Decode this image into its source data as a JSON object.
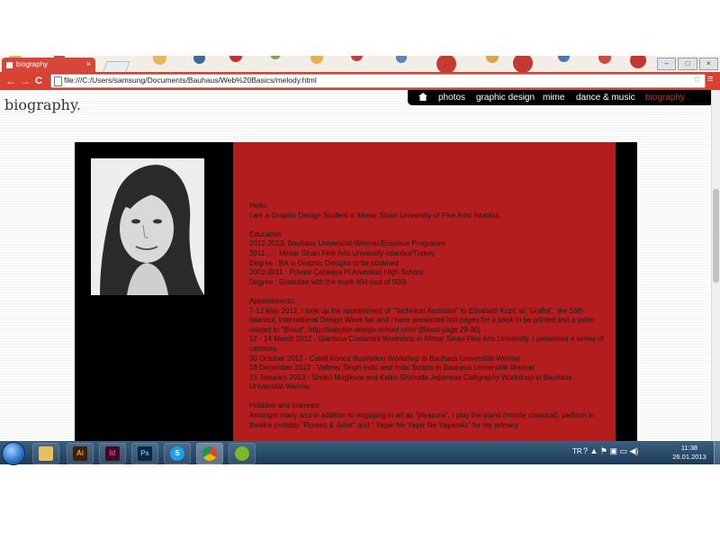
{
  "browser": {
    "tab_title": "biography",
    "tab_close": "×",
    "back": "←",
    "forward": "→",
    "reload": "C",
    "url": "file:///C:/Users/samsung/Documents/Bauhaus/Web%20Basics/melody.html",
    "star": "☆",
    "menu": "≡",
    "window_min": "–",
    "window_max": "□",
    "window_close": "×"
  },
  "page": {
    "title": "biography",
    "title_dot": ".",
    "nav": {
      "home_icon": "home-icon",
      "items": [
        {
          "label": "photos",
          "active": false
        },
        {
          "label": "graphic design",
          "active": false
        },
        {
          "label": "mime",
          "active": false
        },
        {
          "label": "dance & music",
          "active": false
        },
        {
          "label": "biography",
          "active": true
        }
      ]
    },
    "bio": {
      "greeting": "Hello,",
      "intro": "I am a Graphic Design Student in Mimar Sinan University of Fine Arts/ İstanbul.",
      "education_heading": "Education",
      "education": [
        "2012-2013: Bauhaus Universität-Weimar/Erasmus Programm",
        "2011-... : Mimar Sinan Fine Arts University-İstanbul/Turkey",
        "Degree : BA in Graphic Designs to be obtained",
        "2002-2011 : Private Çankaya Pi Anatolian High School",
        "Degree : Graduted with the mark 494 (out of 500)"
      ],
      "appointments_heading": "Appointments:",
      "appointments": [
        "7-12 May 2012, I took up the appointment of \"Technical Assistant\" to Elisabeth Kopf, at \"Grafist\", the 16th İstanbul, International Design Week fair and I have presented two pages for a book to be printed and a video related to \"Blood\". http://babylon-design-school.com/ (Blood-page 29-30)",
        "12 - 14 March 2012 - Gianluca Costantini Workshop in Mimar Sinan Fine Arts University. I presented a series of cartoons.",
        "30 October 2012 - Catell Ronca Illustration Workshop in Bauhaus Universität-Weimar",
        "18 December 2012 - Valbray Singh Indic and Indic Scripts in Bauhaus Universität-Weimar",
        "15 Janurary 2013 - Shoko Mugikura and Keiko Shimoda Japanese Calligraphy Workshop in Bauhaus Universität-Weimar"
      ],
      "hobbies_heading": "Hobbles and Interests :",
      "hobbies": "Amongst many and in addition to engaging in art as \"pleasure\", I play the piano (mostly classical), perform in theatre (notably \"Romeo & Juliet\" and \" Yaşar Ne Yaşar Ne Yaşamaz\" for my primary"
    }
  },
  "taskbar": {
    "apps": [
      {
        "name": "explorer",
        "label": ""
      },
      {
        "name": "illustrator",
        "label": "Ai"
      },
      {
        "name": "indesign",
        "label": "Id"
      },
      {
        "name": "photoshop",
        "label": "Ps"
      },
      {
        "name": "skype",
        "label": "S"
      },
      {
        "name": "chrome",
        "label": ""
      },
      {
        "name": "spotify",
        "label": ""
      }
    ],
    "language": "TR",
    "tray_icons": "? ▲ ⚑ ▣ ▭ ◀)",
    "time": "11:38",
    "date": "26.01.2013"
  },
  "colors": {
    "chrome_red": "#d8412f",
    "panel_red": "#b41d1d",
    "nav_active": "#d52b1e"
  }
}
